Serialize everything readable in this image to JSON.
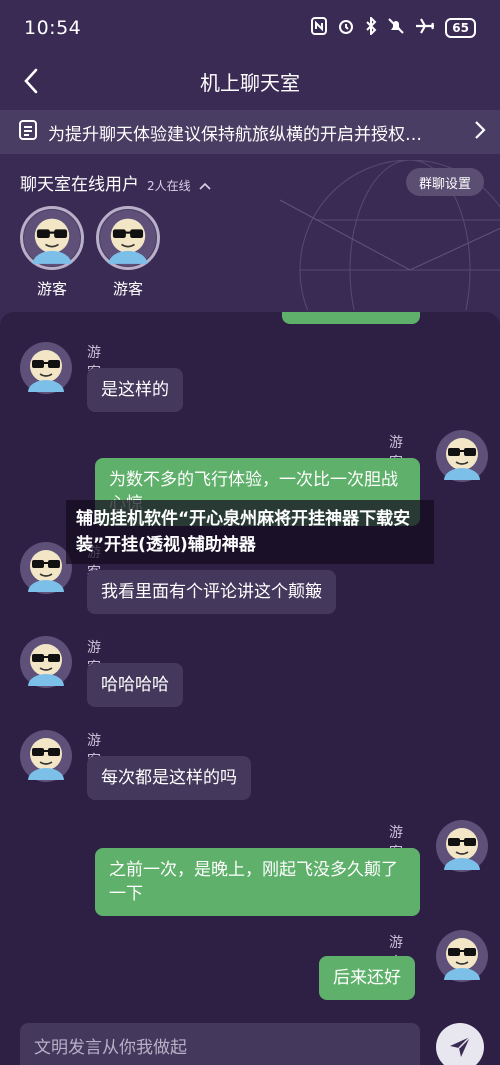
{
  "status": {
    "time": "10:54",
    "battery": "65",
    "icons": [
      "nfc-icon",
      "alarm-icon",
      "bluetooth-icon",
      "mute-icon",
      "airplane-icon",
      "battery-icon"
    ]
  },
  "header": {
    "title": "机上聊天室"
  },
  "notice": {
    "text": "为提升聊天体验建议保持航旅纵横的开启并授权…"
  },
  "online": {
    "title": "聊天室在线用户",
    "count": "2人在线",
    "settings_label": "群聊设置",
    "users": [
      {
        "name": "游客"
      },
      {
        "name": "游客"
      }
    ]
  },
  "overlay": {
    "text": "辅助挂机软件“开心泉州麻将开挂神器下载安装”开挂(透视)辅助神器"
  },
  "messages": [
    {
      "side": "left",
      "name": "游客",
      "text": "是这样的"
    },
    {
      "side": "right",
      "name": "游客",
      "text": "为数不多的飞行体验，一次比一次胆战心惊"
    },
    {
      "side": "left",
      "name": "游客",
      "text": "我看里面有个评论讲这个颠簸"
    },
    {
      "side": "left",
      "name": "游客",
      "text": "哈哈哈哈"
    },
    {
      "side": "left",
      "name": "游客",
      "text": "每次都是这样的吗"
    },
    {
      "side": "right",
      "name": "游客",
      "text": "之前一次，是晚上，刚起飞没多久颠了一下"
    },
    {
      "side": "right",
      "name": "游客",
      "text": "后来还好"
    }
  ],
  "composer": {
    "placeholder": "文明发言从你我做起"
  },
  "colors": {
    "background": "#3a2b55",
    "panel": "#2e1f45",
    "bubble_left": "#44385c",
    "bubble_right": "#5fb06a"
  }
}
